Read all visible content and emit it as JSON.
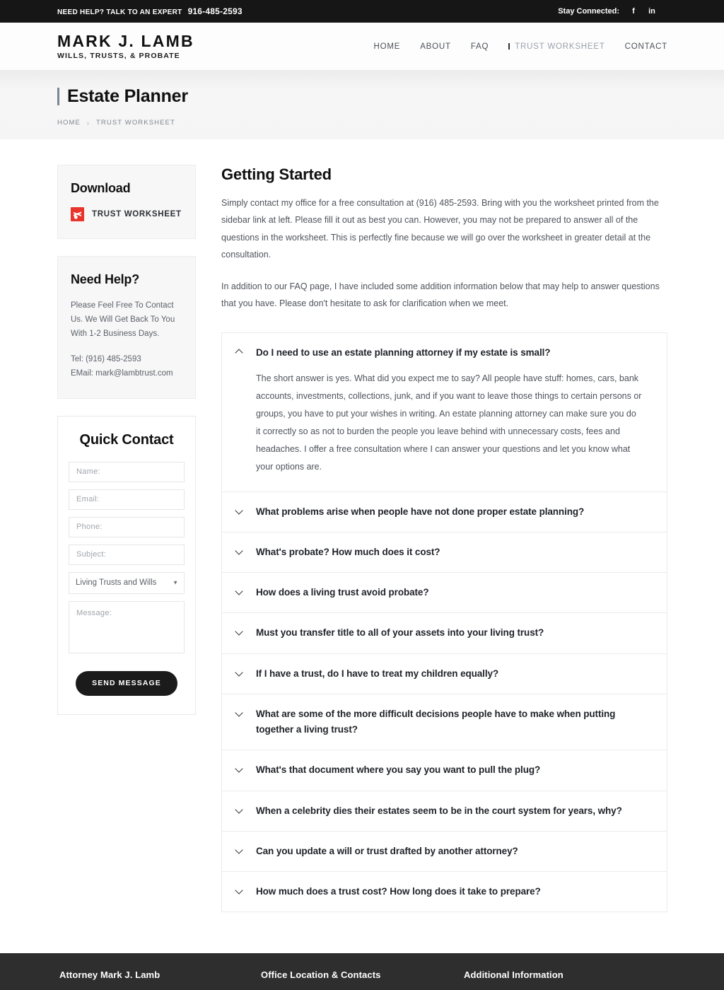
{
  "topbar": {
    "help_text": "NEED HELP? TALK TO AN EXPERT",
    "phone": "916-485-2593",
    "stay_connected_label": "Stay Connected:",
    "social": [
      {
        "name": "facebook-icon",
        "glyph": "f"
      },
      {
        "name": "linkedin-icon",
        "glyph": "in"
      }
    ]
  },
  "header": {
    "logo_main": "MARK J. LAMB",
    "logo_sub": "WILLS, TRUSTS, & PROBATE",
    "nav": [
      {
        "label": "HOME",
        "active": false
      },
      {
        "label": "ABOUT",
        "active": false
      },
      {
        "label": "FAQ",
        "active": false
      },
      {
        "label": "TRUST WORKSHEET",
        "active": true
      },
      {
        "label": "CONTACT",
        "active": false
      }
    ]
  },
  "hero": {
    "title": "Estate Planner",
    "breadcrumb": [
      {
        "label": "HOME"
      },
      {
        "label": "TRUST WORKSHEET"
      }
    ],
    "breadcrumb_separator": "›"
  },
  "sidebar": {
    "download": {
      "heading": "Download",
      "link_label": "TRUST WORKSHEET",
      "icon": "pdf-icon",
      "icon_color": "#e8342a"
    },
    "need_help": {
      "heading": "Need Help?",
      "body": "Please Feel Free To Contact Us. We Will Get Back To You With 1-2 Business Days.",
      "tel": "Tel: (916) 485-2593",
      "email": "EMail: mark@lambtrust.com"
    },
    "quick_contact": {
      "heading": "Quick Contact",
      "fields": [
        {
          "name": "name-field",
          "placeholder": "Name:",
          "value": ""
        },
        {
          "name": "email-field",
          "placeholder": "Email:",
          "value": ""
        },
        {
          "name": "phone-field",
          "placeholder": "Phone:",
          "value": ""
        },
        {
          "name": "subject-field",
          "placeholder": "Subject:",
          "value": ""
        }
      ],
      "select": {
        "selected": "Living Trusts and Wills",
        "options": [
          "Living Trusts and Wills"
        ]
      },
      "message": {
        "placeholder": "Message:",
        "value": ""
      },
      "submit_label": "SEND MESSAGE"
    }
  },
  "main": {
    "heading": "Getting Started",
    "paragraphs": [
      "Simply contact my office for a free consultation at (916) 485-2593. Bring with you the worksheet printed from the sidebar link at left. Please fill it out as best you can. However, you may not be prepared to answer all of the questions in the worksheet. This is perfectly fine because we will go over the worksheet in greater detail at the consultation.",
      "In addition to our FAQ page, I have included some addition information below that may help to answer questions that you have. Please don't hesitate to ask for clarification when we meet."
    ],
    "accordion": [
      {
        "question": "Do I need to use an estate planning attorney if my estate is small?",
        "open": true,
        "answer": "The short answer is yes. What did you expect me to say? All people have stuff: homes, cars, bank accounts, investments, collections, junk, and if you want to leave those things to certain persons or groups, you have to put your wishes in writing. An estate planning attorney can make sure you do it correctly so as not to burden the people you leave behind with unnecessary costs, fees and headaches. I offer a free consultation where I can answer your questions and let you know what your options are."
      },
      {
        "question": "What problems arise when people have not done proper estate planning?",
        "open": false,
        "answer": ""
      },
      {
        "question": "What's probate? How much does it cost?",
        "open": false,
        "answer": ""
      },
      {
        "question": "How does a living trust avoid probate?",
        "open": false,
        "answer": ""
      },
      {
        "question": "Must you transfer title to all of your assets into your living trust?",
        "open": false,
        "answer": ""
      },
      {
        "question": "If I have a trust, do I have to treat my children equally?",
        "open": false,
        "answer": ""
      },
      {
        "question": "What are some of the more difficult decisions people have to make when putting together a living trust?",
        "open": false,
        "answer": ""
      },
      {
        "question": "What's that document where you say you want to pull the plug?",
        "open": false,
        "answer": ""
      },
      {
        "question": "When a celebrity dies their estates seem to be in the court system for years, why?",
        "open": false,
        "answer": ""
      },
      {
        "question": "Can you update a will or trust drafted by another attorney?",
        "open": false,
        "answer": ""
      },
      {
        "question": "How much does a trust cost? How long does it take to prepare?",
        "open": false,
        "answer": ""
      }
    ]
  },
  "footer": {
    "columns": [
      {
        "title": "Attorney Mark J. Lamb"
      },
      {
        "title": "Office Location & Contacts"
      },
      {
        "title": "Additional Information"
      }
    ]
  }
}
